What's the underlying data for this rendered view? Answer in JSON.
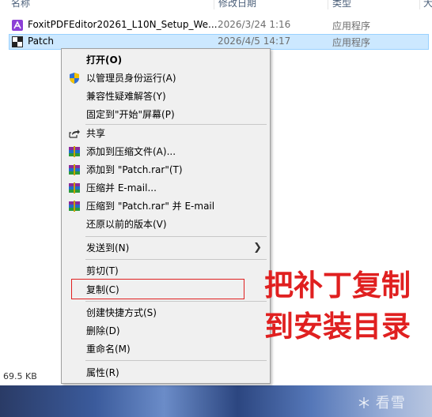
{
  "header": {
    "col_name": "名称",
    "col_date": "修改日期",
    "col_type": "类型",
    "col_size": "大"
  },
  "files": [
    {
      "name": "FoxitPDFEditor20261_L10N_Setup_We...",
      "date": "2026/3/24 1:16",
      "type": "应用程序",
      "icon": "foxit-app-icon"
    },
    {
      "name": "Patch",
      "date": "2026/4/5 14:17",
      "type": "应用程序",
      "icon": "patch-app-icon"
    }
  ],
  "status": {
    "size": "69.5 KB"
  },
  "context_menu": {
    "open": "打开(O)",
    "run_as_admin": "以管理员身份运行(A)",
    "troubleshoot": "兼容性疑难解答(Y)",
    "pin_start": "固定到\"开始\"屏幕(P)",
    "share": "共享",
    "add_archive": "添加到压缩文件(A)...",
    "add_rar": "添加到 \"Patch.rar\"(T)",
    "compress_email": "压缩并 E-mail...",
    "compress_rar_email": "压缩到 \"Patch.rar\" 并 E-mail",
    "restore": "还原以前的版本(V)",
    "send_to": "发送到(N)",
    "cut": "剪切(T)",
    "copy": "复制(C)",
    "create_shortcut": "创建快捷方式(S)",
    "delete": "删除(D)",
    "rename": "重命名(M)",
    "properties": "属性(R)"
  },
  "annotation": {
    "line1": "把补丁复制",
    "line2": "到安装目录"
  },
  "watermark": "看雪",
  "colors": {
    "highlight": "#e02020",
    "selection": "#cce8ff",
    "menu_bg": "#f0f0f0"
  }
}
